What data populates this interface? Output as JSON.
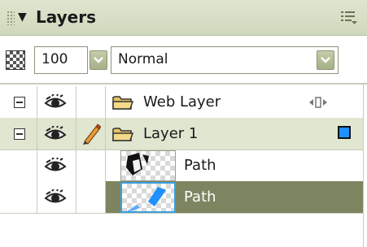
{
  "panel": {
    "title": "Layers",
    "icons": {
      "collapse": "collapse-triangle-icon",
      "grip": "grip-icon",
      "options": "options-menu-icon"
    }
  },
  "blend": {
    "opacity": "100",
    "mode": "Normal",
    "opacity_icon": "opacity-checker-icon"
  },
  "layers": [
    {
      "name": "Web Layer",
      "type": "folder",
      "expanded": true,
      "visible": true,
      "selected": false,
      "indicator": "web-layer-drag-icon"
    },
    {
      "name": "Layer 1",
      "type": "folder",
      "expanded": true,
      "visible": true,
      "editing": true,
      "selected": false,
      "color": "#1e90ff"
    },
    {
      "name": "Path",
      "type": "object",
      "visible": true,
      "selected": false
    },
    {
      "name": "Path",
      "type": "object",
      "visible": true,
      "selected": true
    }
  ],
  "colors": {
    "titlebar": "#cfd8bd",
    "selected_row": "#7c8560",
    "active_layer_row": "#e0e6d0",
    "layer_color_chip": "#1e90ff"
  }
}
